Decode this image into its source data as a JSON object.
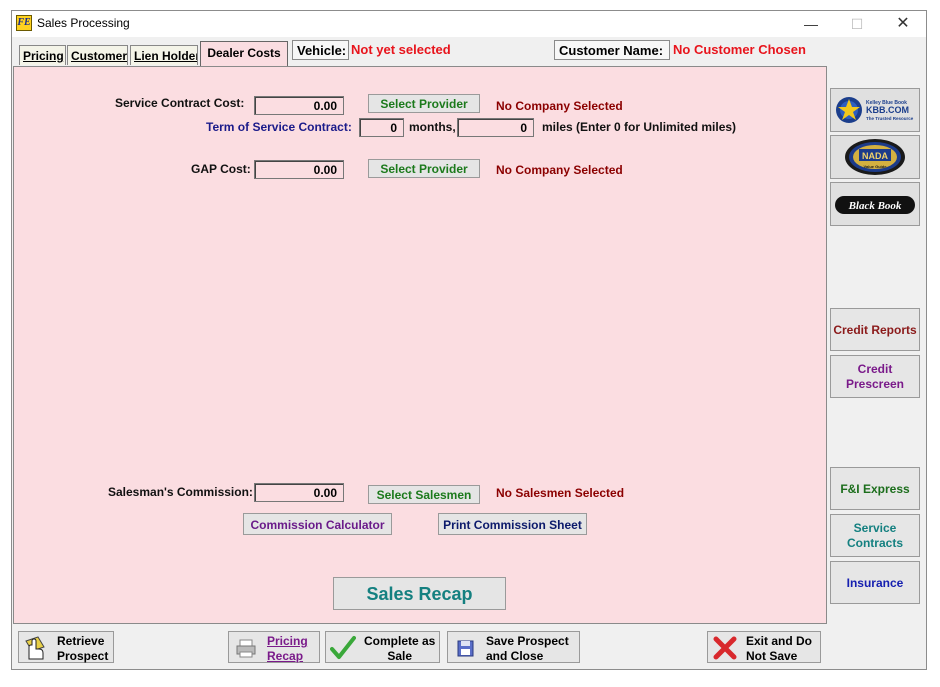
{
  "window": {
    "title": "Sales Processing",
    "app_icon_letter": "FE"
  },
  "tabs": {
    "pricing": "Pricing",
    "customer": "Customer",
    "lien": "Lien Holder",
    "dealer": "Dealer Costs"
  },
  "header": {
    "vehicle_label": "Vehicle:",
    "vehicle_value": "Not yet selected",
    "customer_label": "Customer Name:",
    "customer_value": "No Customer Chosen"
  },
  "service_contract": {
    "label": "Service Contract Cost:",
    "value": "0.00",
    "button": "Select Provider",
    "status": "No Company Selected",
    "term_label": "Term of Service Contract:",
    "months_value": "0",
    "months_label": "months,",
    "miles_value": "0",
    "miles_label": "miles (Enter 0 for Unlimited miles)"
  },
  "gap": {
    "label": "GAP Cost:",
    "value": "0.00",
    "button": "Select Provider",
    "status": "No Company Selected"
  },
  "commission": {
    "label": "Salesman's Commission:",
    "value": "0.00",
    "button": "Select Salesmen",
    "status": "No Salesmen Selected",
    "calculator": "Commission Calculator",
    "print_sheet": "Print Commission Sheet"
  },
  "sales_recap": "Sales Recap",
  "sidebar": {
    "kbb_small": "Kelley Blue Book",
    "kbb_main": "KBB.COM",
    "kbb_tag": "The Trusted Resource",
    "nada": "NADA",
    "nada_sub": "Value Guide",
    "blackbook": "Black Book",
    "credit_reports": "Credit Reports",
    "credit_prescreen": "Credit\nPrescreen",
    "fi_express": "F&I Express",
    "service_contracts": "Service\nContracts",
    "insurance": "Insurance"
  },
  "bottom": {
    "retrieve": "Retrieve\nProspect",
    "pricing_recap": "Pricing\nRecap",
    "complete": "Complete as\nSale",
    "save": "Save Prospect\nand Close",
    "exit": "Exit and Do\nNot Save"
  },
  "colors": {
    "panel_bg": "#fbdde1",
    "status_red": "#e8141c",
    "status_dark_red": "#8b0000",
    "select_green": "#1c7a1c",
    "recap_teal": "#148080"
  }
}
